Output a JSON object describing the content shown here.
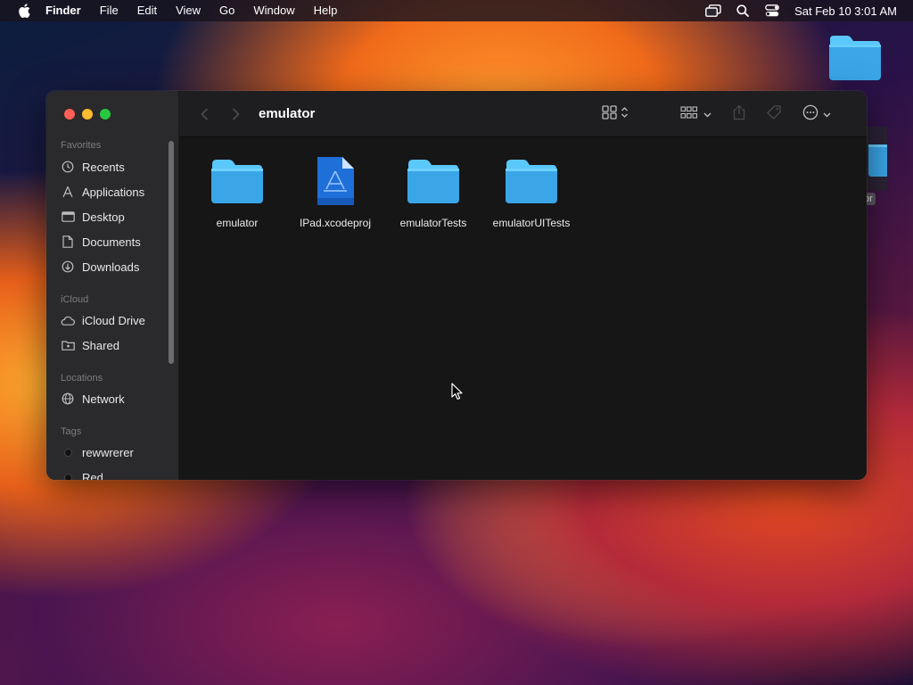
{
  "menubar": {
    "app_name": "Finder",
    "menus": [
      "File",
      "Edit",
      "View",
      "Go",
      "Window",
      "Help"
    ],
    "clock": "Sat Feb 10  3:01 AM",
    "status_icons": [
      "screen-mirroring-icon",
      "search-icon",
      "control-center-icon"
    ]
  },
  "desktop": {
    "partial_folder_label": "or"
  },
  "window": {
    "title": "emulator",
    "sidebar": {
      "favorites_header": "Favorites",
      "favorites": [
        {
          "label": "Recents",
          "icon": "clock-icon"
        },
        {
          "label": "Applications",
          "icon": "applications-icon"
        },
        {
          "label": "Desktop",
          "icon": "desktop-icon"
        },
        {
          "label": "Documents",
          "icon": "document-icon"
        },
        {
          "label": "Downloads",
          "icon": "download-icon"
        }
      ],
      "icloud_header": "iCloud",
      "icloud": [
        {
          "label": "iCloud Drive",
          "icon": "cloud-icon"
        },
        {
          "label": "Shared",
          "icon": "shared-folder-icon"
        }
      ],
      "locations_header": "Locations",
      "locations": [
        {
          "label": "Network",
          "icon": "globe-icon"
        }
      ],
      "tags_header": "Tags",
      "tags": [
        {
          "label": "rewwrerer"
        },
        {
          "label": "Red"
        }
      ]
    },
    "files": [
      {
        "name": "emulator",
        "kind": "folder"
      },
      {
        "name": "IPad.xcodeproj",
        "kind": "xcodeproj"
      },
      {
        "name": "emulatorTests",
        "kind": "folder"
      },
      {
        "name": "emulatorUITests",
        "kind": "folder"
      }
    ]
  },
  "colors": {
    "folder_top": "#5ac8fa",
    "folder_body": "#3aa6e8",
    "accent": "#0a84ff"
  }
}
